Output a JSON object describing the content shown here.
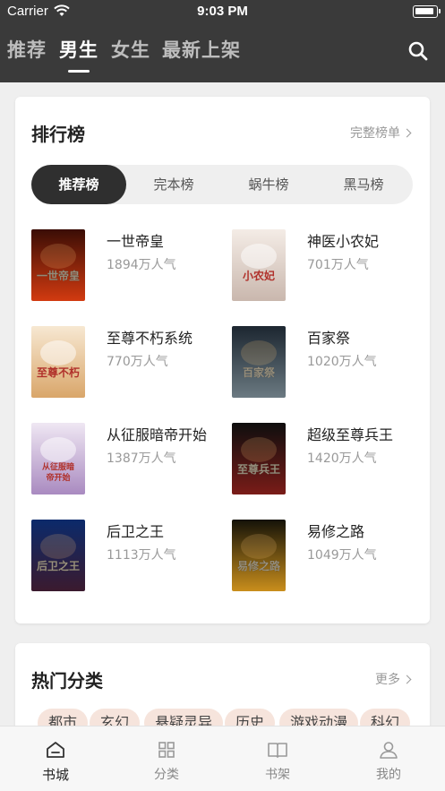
{
  "status_bar": {
    "carrier": "Carrier",
    "time": "9:03 PM"
  },
  "nav": {
    "tabs": [
      {
        "label": "推荐",
        "active": false
      },
      {
        "label": "男生",
        "active": true
      },
      {
        "label": "女生",
        "active": false
      },
      {
        "label": "最新上架",
        "active": false
      }
    ],
    "search_icon": "search-icon"
  },
  "ranking": {
    "title": "排行榜",
    "more_label": "完整榜单",
    "segments": [
      {
        "label": "推荐榜",
        "active": true
      },
      {
        "label": "完本榜",
        "active": false
      },
      {
        "label": "蜗牛榜",
        "active": false
      },
      {
        "label": "黑马榜",
        "active": false
      }
    ],
    "books": [
      {
        "title": "一世帝皇",
        "popularity": "1894万人气",
        "cover_text": "一世帝皇",
        "colors": [
          "#3a0d05",
          "#d23a10"
        ]
      },
      {
        "title": "神医小农妃",
        "popularity": "701万人气",
        "cover_text": "小农妃",
        "colors": [
          "#f4ece6",
          "#c9b7ad"
        ]
      },
      {
        "title": "至尊不朽系统",
        "popularity": "770万人气",
        "cover_text": "至尊不朽",
        "colors": [
          "#f7e8d2",
          "#d9a66a"
        ]
      },
      {
        "title": "百家祭",
        "popularity": "1020万人气",
        "cover_text": "百家祭",
        "colors": [
          "#1c2630",
          "#6b7a82"
        ]
      },
      {
        "title": "从征服暗帝开始",
        "popularity": "1387万人气",
        "cover_text": "从征服暗帝开始",
        "colors": [
          "#efe7f3",
          "#a98ac0"
        ]
      },
      {
        "title": "超级至尊兵王",
        "popularity": "1420万人气",
        "cover_text": "至尊兵王",
        "colors": [
          "#0e0e0e",
          "#7a1c18"
        ]
      },
      {
        "title": "后卫之王",
        "popularity": "1113万人气",
        "cover_text": "后卫之王",
        "colors": [
          "#0b2a6b",
          "#3b1a2e"
        ]
      },
      {
        "title": "易修之路",
        "popularity": "1049万人气",
        "cover_text": "易修之路",
        "colors": [
          "#141208",
          "#c98e1c"
        ]
      }
    ]
  },
  "categories": {
    "title": "热门分类",
    "more_label": "更多",
    "chips": [
      "都市",
      "玄幻",
      "悬疑灵异",
      "历史",
      "游戏动漫",
      "科幻"
    ]
  },
  "tabbar": {
    "items": [
      {
        "label": "书城",
        "icon": "home-icon",
        "active": true
      },
      {
        "label": "分类",
        "icon": "grid-icon",
        "active": false
      },
      {
        "label": "书架",
        "icon": "book-icon",
        "active": false
      },
      {
        "label": "我的",
        "icon": "user-icon",
        "active": false
      }
    ]
  }
}
